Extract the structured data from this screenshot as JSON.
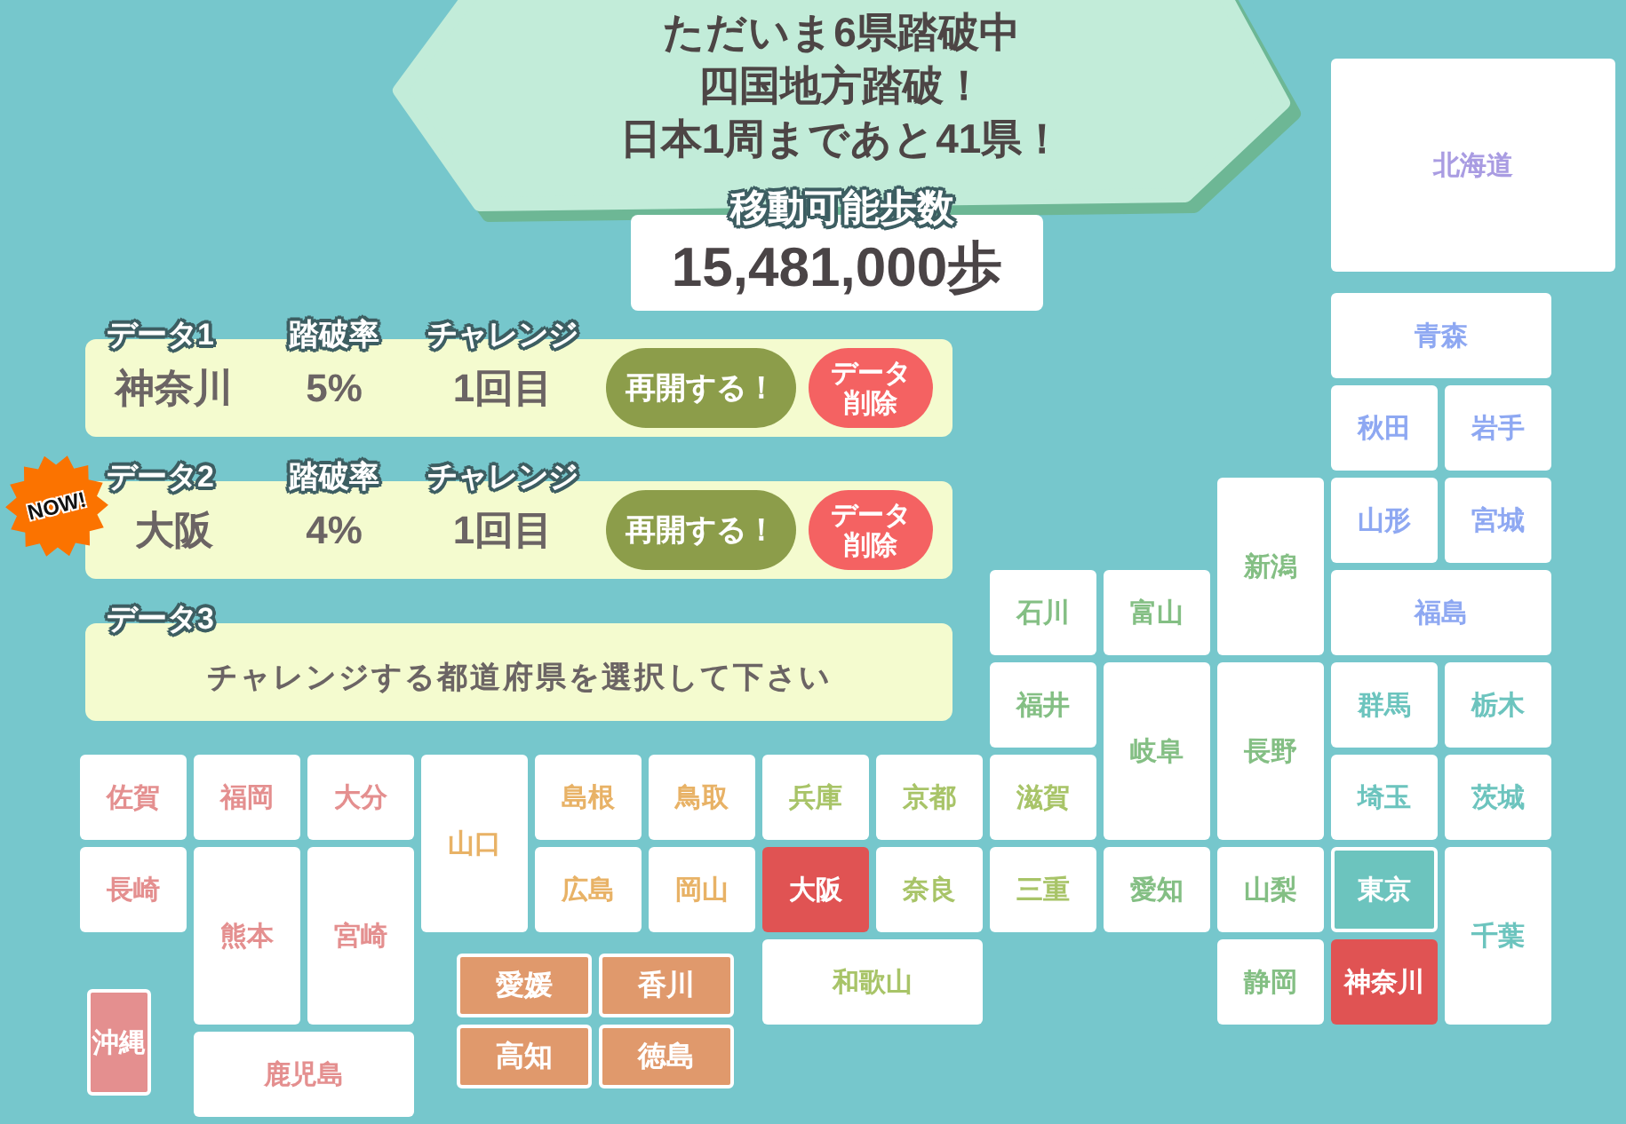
{
  "banner": {
    "lines": [
      "ただいま6県踏破中",
      "四国地方踏破！",
      "日本1周まであと41県！"
    ]
  },
  "steps": {
    "label": "移動可能歩数",
    "value": "15,481,000歩"
  },
  "saves": [
    {
      "kind": "saved",
      "label": "データ1",
      "rate_header": "踏破率",
      "challenge_header": "チャレンジ",
      "prefecture": "神奈川",
      "rate": "5%",
      "challenge": "1回目",
      "resume": "再開する！",
      "delete": [
        "データ",
        "削除"
      ]
    },
    {
      "kind": "saved",
      "label": "データ2",
      "rate_header": "踏破率",
      "challenge_header": "チャレンジ",
      "prefecture": "大阪",
      "rate": "4%",
      "challenge": "1回目",
      "resume": "再開する！",
      "delete": [
        "データ",
        "削除"
      ],
      "badge": "NOW!"
    },
    {
      "kind": "empty",
      "label": "データ3",
      "message": "チャレンジする都道府県を選択して下さい"
    }
  ],
  "map": {
    "prefectures": [
      {
        "name": "北海道",
        "color": "#a99ce2",
        "conquered": false,
        "in_progress": false
      },
      {
        "name": "青森",
        "color": "#8ea8f2",
        "conquered": false,
        "in_progress": false
      },
      {
        "name": "秋田",
        "color": "#8ea8f2",
        "conquered": false,
        "in_progress": false
      },
      {
        "name": "岩手",
        "color": "#8ea8f2",
        "conquered": false,
        "in_progress": false
      },
      {
        "name": "新潟",
        "color": "#84bf84",
        "conquered": false,
        "in_progress": false
      },
      {
        "name": "山形",
        "color": "#8ea8f2",
        "conquered": false,
        "in_progress": false
      },
      {
        "name": "宮城",
        "color": "#8ea8f2",
        "conquered": false,
        "in_progress": false
      },
      {
        "name": "石川",
        "color": "#84bf84",
        "conquered": false,
        "in_progress": false
      },
      {
        "name": "富山",
        "color": "#84bf84",
        "conquered": false,
        "in_progress": false
      },
      {
        "name": "福島",
        "color": "#8ea8f2",
        "conquered": false,
        "in_progress": false
      },
      {
        "name": "福井",
        "color": "#84bf84",
        "conquered": false,
        "in_progress": false
      },
      {
        "name": "岐阜",
        "color": "#84bf84",
        "conquered": false,
        "in_progress": false
      },
      {
        "name": "長野",
        "color": "#84bf84",
        "conquered": false,
        "in_progress": false
      },
      {
        "name": "群馬",
        "color": "#6cc4be",
        "conquered": false,
        "in_progress": false
      },
      {
        "name": "栃木",
        "color": "#6cc4be",
        "conquered": false,
        "in_progress": false
      },
      {
        "name": "佐賀",
        "color": "#e48f8f",
        "conquered": false,
        "in_progress": false
      },
      {
        "name": "福岡",
        "color": "#e48f8f",
        "conquered": false,
        "in_progress": false
      },
      {
        "name": "大分",
        "color": "#e48f8f",
        "conquered": false,
        "in_progress": false
      },
      {
        "name": "山口",
        "color": "#e8b266",
        "conquered": false,
        "in_progress": false
      },
      {
        "name": "島根",
        "color": "#e8b266",
        "conquered": false,
        "in_progress": false
      },
      {
        "name": "鳥取",
        "color": "#e8b266",
        "conquered": false,
        "in_progress": false
      },
      {
        "name": "兵庫",
        "color": "#a8c468",
        "conquered": false,
        "in_progress": false
      },
      {
        "name": "京都",
        "color": "#a8c468",
        "conquered": false,
        "in_progress": false
      },
      {
        "name": "滋賀",
        "color": "#a8c468",
        "conquered": false,
        "in_progress": false
      },
      {
        "name": "埼玉",
        "color": "#6cc4be",
        "conquered": false,
        "in_progress": false
      },
      {
        "name": "茨城",
        "color": "#6cc4be",
        "conquered": false,
        "in_progress": false
      },
      {
        "name": "長崎",
        "color": "#e48f8f",
        "conquered": false,
        "in_progress": false
      },
      {
        "name": "熊本",
        "color": "#e48f8f",
        "conquered": false,
        "in_progress": false
      },
      {
        "name": "宮崎",
        "color": "#e48f8f",
        "conquered": false,
        "in_progress": false
      },
      {
        "name": "広島",
        "color": "#e8b266",
        "conquered": false,
        "in_progress": false
      },
      {
        "name": "岡山",
        "color": "#e8b266",
        "conquered": false,
        "in_progress": false
      },
      {
        "name": "大阪",
        "conquered": false,
        "in_progress": true
      },
      {
        "name": "奈良",
        "color": "#a8c468",
        "conquered": false,
        "in_progress": false
      },
      {
        "name": "三重",
        "color": "#a8c468",
        "conquered": false,
        "in_progress": false
      },
      {
        "name": "愛知",
        "color": "#84bf84",
        "conquered": false,
        "in_progress": false
      },
      {
        "name": "山梨",
        "color": "#84bf84",
        "conquered": false,
        "in_progress": false
      },
      {
        "name": "東京",
        "color": "#6cc4be",
        "conquered": true,
        "in_progress": false
      },
      {
        "name": "千葉",
        "color": "#6cc4be",
        "conquered": false,
        "in_progress": false
      },
      {
        "name": "愛媛",
        "color": "#e0996c",
        "conquered": true,
        "in_progress": false
      },
      {
        "name": "香川",
        "color": "#e0996c",
        "conquered": true,
        "in_progress": false
      },
      {
        "name": "和歌山",
        "color": "#a8c468",
        "conquered": false,
        "in_progress": false
      },
      {
        "name": "静岡",
        "color": "#84bf84",
        "conquered": false,
        "in_progress": false
      },
      {
        "name": "神奈川",
        "conquered": false,
        "in_progress": true
      },
      {
        "name": "沖縄",
        "color": "#e48f8f",
        "conquered": true,
        "in_progress": false
      },
      {
        "name": "鹿児島",
        "color": "#e48f8f",
        "conquered": false,
        "in_progress": false
      },
      {
        "name": "高知",
        "color": "#e0996c",
        "conquered": true,
        "in_progress": false
      },
      {
        "name": "徳島",
        "color": "#e0996c",
        "conquered": true,
        "in_progress": false
      }
    ]
  }
}
